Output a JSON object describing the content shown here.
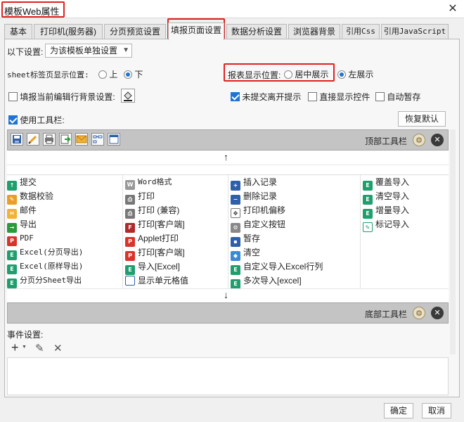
{
  "window": {
    "title": "模板Web属性",
    "close_glyph": "✕"
  },
  "tabs": [
    {
      "label": "基本",
      "active": false
    },
    {
      "label": "打印机(服务器)",
      "active": false
    },
    {
      "label": "分页预览设置",
      "active": false
    },
    {
      "label": "填报页面设置",
      "active": true
    },
    {
      "label": "数据分析设置",
      "active": false
    },
    {
      "label": "浏览器背景",
      "active": false
    },
    {
      "label": "引用Css",
      "active": false
    },
    {
      "label": "引用JavaScript",
      "active": false
    }
  ],
  "settings": {
    "scope_label": "以下设置:",
    "scope_value": "为该模板单独设置",
    "sheet_tab_label": "sheet标签页显示位置:",
    "sheet_tab_options": [
      "上",
      "下"
    ],
    "sheet_tab_selected": "下",
    "report_pos_label": "报表显示位置:",
    "report_pos_options": [
      "居中展示",
      "左展示"
    ],
    "report_pos_selected": "左展示",
    "bg_checkbox_label": "填报当前编辑行背景设置:",
    "bg_checkbox_checked": false,
    "unsubmitted_label": "未提交离开提示",
    "unsubmitted_checked": true,
    "direct_widget_label": "直接显示控件",
    "direct_widget_checked": false,
    "autosave_label": "自动暂存",
    "autosave_checked": false
  },
  "toolbar": {
    "use_toolbar_label": "使用工具栏:",
    "use_toolbar_checked": true,
    "restore_default": "恢复默认",
    "top_bar_label": "顶部工具栏",
    "bottom_bar_label": "底部工具栏",
    "up_arrow": "↑",
    "down_arrow": "↓",
    "top_icons": [
      "save-icon",
      "validate-icon",
      "print-icon",
      "export-icon",
      "mail-icon",
      "column-icon",
      "blank-icon"
    ]
  },
  "buttons": {
    "col1": [
      {
        "label": "提交",
        "icon": "submit-icon"
      },
      {
        "label": "数据校验",
        "icon": "validate-icon"
      },
      {
        "label": "邮件",
        "icon": "mail-icon"
      },
      {
        "label": "导出",
        "icon": "export-icon"
      },
      {
        "label": "PDF",
        "icon": "pdf-icon"
      },
      {
        "label": "Excel(分页导出)",
        "icon": "excel-icon"
      },
      {
        "label": "Excel(原样导出)",
        "icon": "excel-icon"
      },
      {
        "label": "分页分Sheet导出",
        "icon": "excel-icon"
      }
    ],
    "col2": [
      {
        "label": "Word格式",
        "icon": "word-icon"
      },
      {
        "label": "打印",
        "icon": "print-icon"
      },
      {
        "label": "打印 (兼容)",
        "icon": "print-icon"
      },
      {
        "label": "打印[客户端]",
        "icon": "flash-print-icon"
      },
      {
        "label": "Applet打印",
        "icon": "pdf-icon"
      },
      {
        "label": "打印[客户端]",
        "icon": "pdf-icon"
      },
      {
        "label": "导入[Excel]",
        "icon": "excel-icon"
      },
      {
        "label": "显示单元格值",
        "icon": "cell-value-icon"
      }
    ],
    "col3": [
      {
        "label": "插入记录",
        "icon": "insert-row-icon"
      },
      {
        "label": "删除记录",
        "icon": "delete-row-icon"
      },
      {
        "label": "打印机偏移",
        "icon": "move-icon"
      },
      {
        "label": "自定义按钮",
        "icon": "gear-icon"
      },
      {
        "label": "暂存",
        "icon": "save-icon"
      },
      {
        "label": "清空",
        "icon": "eraser-icon"
      },
      {
        "label": "自定义导入Excel行列",
        "icon": "excel-icon"
      },
      {
        "label": "多次导入[excel]",
        "icon": "excel-icon"
      }
    ],
    "col4": [
      {
        "label": "覆盖导入",
        "icon": "excel-icon"
      },
      {
        "label": "清空导入",
        "icon": "excel-icon"
      },
      {
        "label": "增量导入",
        "icon": "excel-icon"
      },
      {
        "label": "标记导入",
        "icon": "mark-import-icon"
      }
    ]
  },
  "events": {
    "label": "事件设置:"
  },
  "footer": {
    "ok": "确定",
    "cancel": "取消"
  },
  "colors": {
    "accent": "#1e74d0",
    "highlight": "#e02020",
    "excel_green": "#1f9e6e",
    "pdf_red": "#d9342b"
  }
}
